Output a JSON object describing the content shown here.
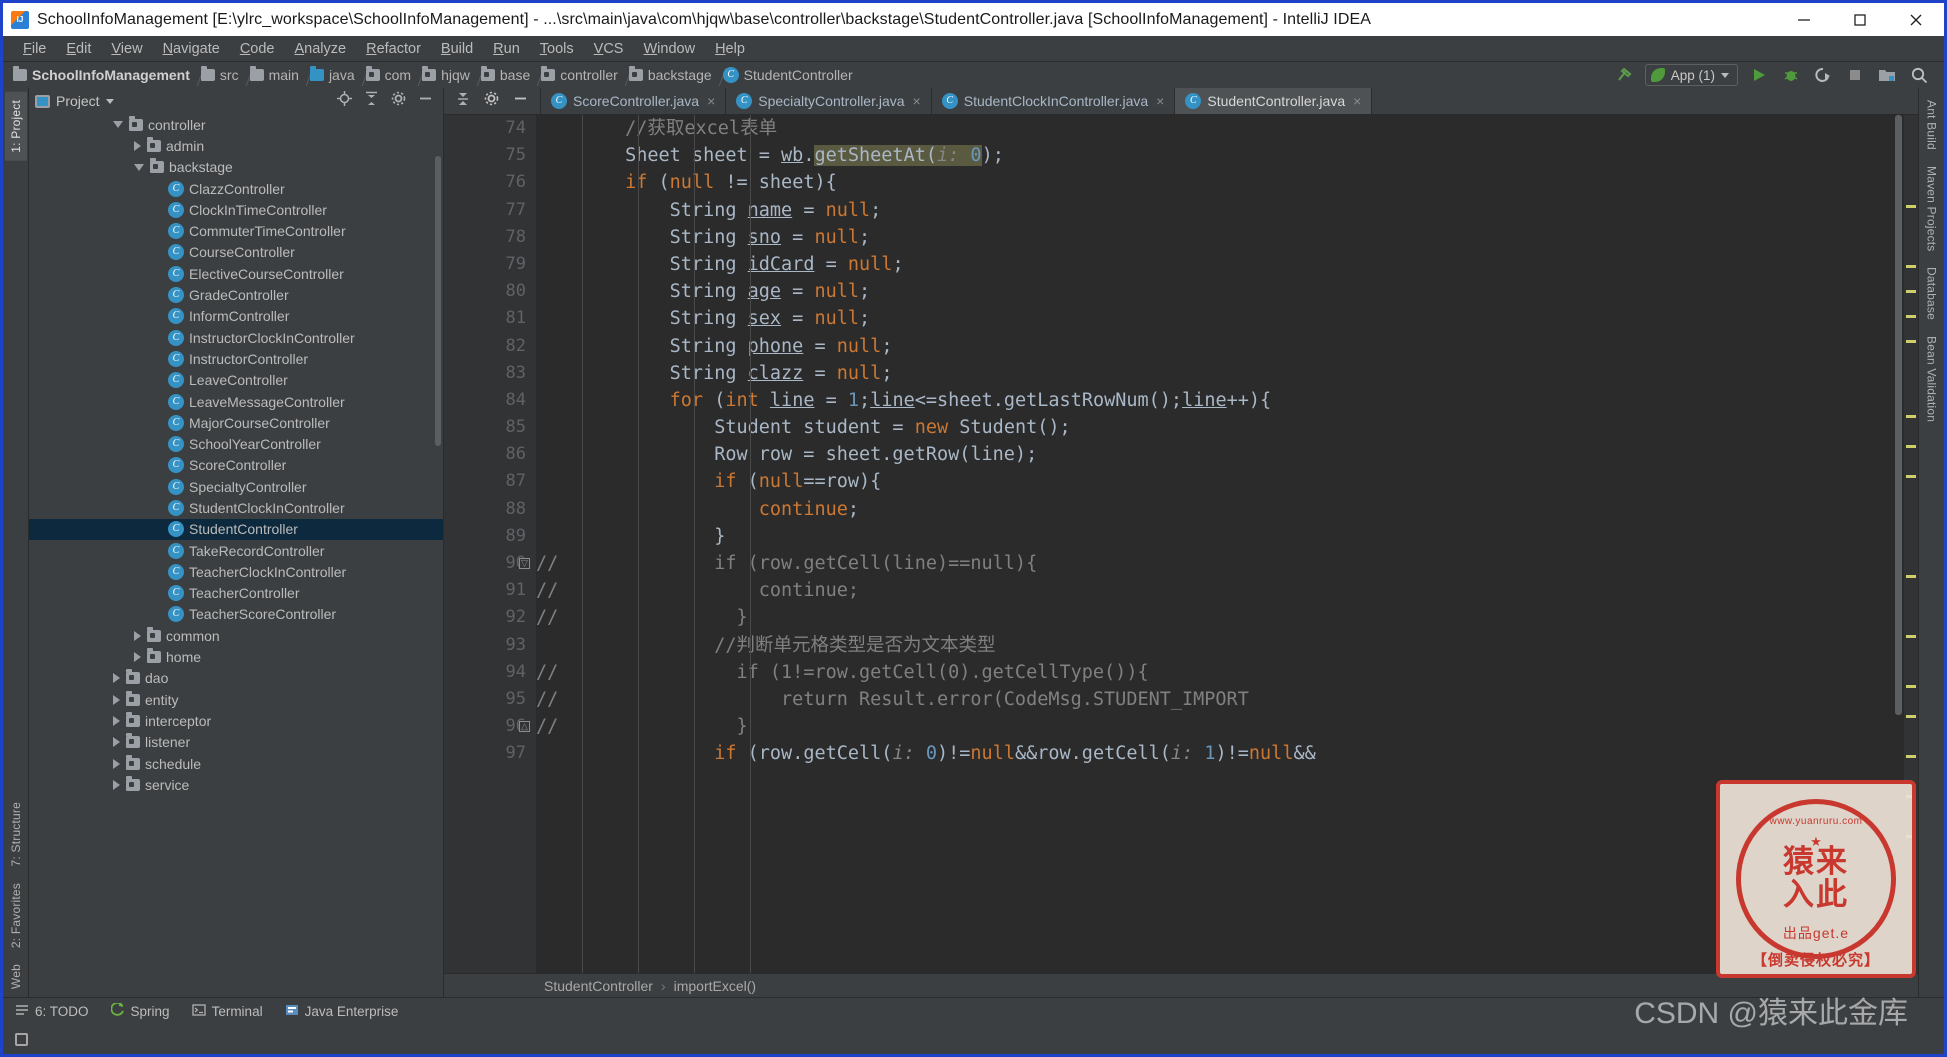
{
  "window": {
    "title": "SchoolInfoManagement [E:\\ylrc_workspace\\SchoolInfoManagement] - ...\\src\\main\\java\\com\\hjqw\\base\\controller\\backstage\\StudentController.java [SchoolInfoManagement] - IntelliJ IDEA",
    "minimize": "─",
    "maximize": "□",
    "close": "✕"
  },
  "menubar": {
    "items": [
      "File",
      "Edit",
      "View",
      "Navigate",
      "Code",
      "Analyze",
      "Refactor",
      "Build",
      "Run",
      "Tools",
      "VCS",
      "Window",
      "Help"
    ]
  },
  "breadcrumb": {
    "items": [
      {
        "label": "SchoolInfoManagement",
        "icon": "project-folder-icon"
      },
      {
        "label": "src",
        "icon": "folder-icon"
      },
      {
        "label": "main",
        "icon": "folder-icon"
      },
      {
        "label": "java",
        "icon": "source-folder-icon"
      },
      {
        "label": "com",
        "icon": "package-icon"
      },
      {
        "label": "hjqw",
        "icon": "package-icon"
      },
      {
        "label": "base",
        "icon": "package-icon"
      },
      {
        "label": "controller",
        "icon": "package-icon"
      },
      {
        "label": "backstage",
        "icon": "package-icon"
      },
      {
        "label": "StudentController",
        "icon": "class-icon"
      }
    ]
  },
  "toolbar": {
    "run_config": "App (1)",
    "run": "run-icon",
    "debug": "debug-icon",
    "coverage": "coverage-icon",
    "stop": "stop-icon",
    "project_structure": "project-structure-icon",
    "search": "search-icon",
    "build_hammer": "build-icon"
  },
  "project_panel": {
    "title": "Project",
    "actions": [
      "locate-icon",
      "collapse-all-icon",
      "settings-icon",
      "hide-icon"
    ],
    "tree": [
      {
        "label": "controller",
        "indent": 4,
        "type": "folder",
        "arrow": "open"
      },
      {
        "label": "admin",
        "indent": 5,
        "type": "folder",
        "arrow": "closed"
      },
      {
        "label": "backstage",
        "indent": 5,
        "type": "folder",
        "arrow": "open"
      },
      {
        "label": "ClazzController",
        "indent": 6,
        "type": "class",
        "arrow": "none"
      },
      {
        "label": "ClockInTimeController",
        "indent": 6,
        "type": "class",
        "arrow": "none"
      },
      {
        "label": "CommuterTimeController",
        "indent": 6,
        "type": "class",
        "arrow": "none"
      },
      {
        "label": "CourseController",
        "indent": 6,
        "type": "class",
        "arrow": "none"
      },
      {
        "label": "ElectiveCourseController",
        "indent": 6,
        "type": "class",
        "arrow": "none"
      },
      {
        "label": "GradeController",
        "indent": 6,
        "type": "class",
        "arrow": "none"
      },
      {
        "label": "InformController",
        "indent": 6,
        "type": "class",
        "arrow": "none"
      },
      {
        "label": "InstructorClockInController",
        "indent": 6,
        "type": "class",
        "arrow": "none"
      },
      {
        "label": "InstructorController",
        "indent": 6,
        "type": "class",
        "arrow": "none"
      },
      {
        "label": "LeaveController",
        "indent": 6,
        "type": "class",
        "arrow": "none"
      },
      {
        "label": "LeaveMessageController",
        "indent": 6,
        "type": "class",
        "arrow": "none"
      },
      {
        "label": "MajorCourseController",
        "indent": 6,
        "type": "class",
        "arrow": "none"
      },
      {
        "label": "SchoolYearController",
        "indent": 6,
        "type": "class",
        "arrow": "none"
      },
      {
        "label": "ScoreController",
        "indent": 6,
        "type": "class",
        "arrow": "none"
      },
      {
        "label": "SpecialtyController",
        "indent": 6,
        "type": "class",
        "arrow": "none"
      },
      {
        "label": "StudentClockInController",
        "indent": 6,
        "type": "class",
        "arrow": "none"
      },
      {
        "label": "StudentController",
        "indent": 6,
        "type": "class",
        "arrow": "none",
        "selected": true
      },
      {
        "label": "TakeRecordController",
        "indent": 6,
        "type": "class",
        "arrow": "none"
      },
      {
        "label": "TeacherClockInController",
        "indent": 6,
        "type": "class",
        "arrow": "none"
      },
      {
        "label": "TeacherController",
        "indent": 6,
        "type": "class",
        "arrow": "none"
      },
      {
        "label": "TeacherScoreController",
        "indent": 6,
        "type": "class",
        "arrow": "none"
      },
      {
        "label": "common",
        "indent": 5,
        "type": "folder",
        "arrow": "closed"
      },
      {
        "label": "home",
        "indent": 5,
        "type": "folder",
        "arrow": "closed"
      },
      {
        "label": "dao",
        "indent": 4,
        "type": "folder",
        "arrow": "closed"
      },
      {
        "label": "entity",
        "indent": 4,
        "type": "folder",
        "arrow": "closed"
      },
      {
        "label": "interceptor",
        "indent": 4,
        "type": "folder",
        "arrow": "closed"
      },
      {
        "label": "listener",
        "indent": 4,
        "type": "folder",
        "arrow": "closed"
      },
      {
        "label": "schedule",
        "indent": 4,
        "type": "folder",
        "arrow": "closed"
      },
      {
        "label": "service",
        "indent": 4,
        "type": "folder",
        "arrow": "closed"
      }
    ]
  },
  "left_tool_tabs": [
    {
      "label": "1: Project",
      "selected": true
    },
    {
      "label": "7: Structure",
      "selected": false
    },
    {
      "label": "2: Favorites",
      "selected": false
    },
    {
      "label": "Web",
      "selected": false
    }
  ],
  "right_tool_tabs": [
    {
      "label": "Ant Build"
    },
    {
      "label": "Maven Projects"
    },
    {
      "label": "Database"
    },
    {
      "label": "Bean Validation"
    }
  ],
  "editor": {
    "tabs": [
      {
        "label": "ScoreController.java",
        "active": false,
        "close": "×"
      },
      {
        "label": "SpecialtyController.java",
        "active": false,
        "close": "×"
      },
      {
        "label": "StudentClockInController.java",
        "active": false,
        "close": "×"
      },
      {
        "label": "StudentController.java",
        "active": true,
        "close": "×"
      }
    ],
    "tab_actions": [
      "collapse-icon",
      "settings-icon",
      "hide-icon"
    ],
    "first_line_number": 74,
    "lines": [
      {
        "n": 74,
        "segments": [
          {
            "t": "        ",
            "c": "plain"
          },
          {
            "t": "//获取excel表单",
            "c": "cmt"
          }
        ]
      },
      {
        "n": 75,
        "segments": [
          {
            "t": "        Sheet sheet = ",
            "c": "plain"
          },
          {
            "t": "wb",
            "c": "ul"
          },
          {
            "t": ".",
            "c": "plain"
          },
          {
            "t": "getSheetAt(",
            "c": "hl"
          },
          {
            "t": "i:",
            "c": "hlhint"
          },
          {
            "t": " ",
            "c": "hl"
          },
          {
            "t": "0",
            "c": "hlnum"
          },
          {
            "t": ");",
            "c": "plain"
          }
        ]
      },
      {
        "n": 76,
        "segments": [
          {
            "t": "        ",
            "c": "plain"
          },
          {
            "t": "if",
            "c": "kw"
          },
          {
            "t": " (",
            "c": "plain"
          },
          {
            "t": "null",
            "c": "kw"
          },
          {
            "t": " != sheet){",
            "c": "plain"
          }
        ]
      },
      {
        "n": 77,
        "segments": [
          {
            "t": "            String ",
            "c": "plain"
          },
          {
            "t": "name",
            "c": "ul"
          },
          {
            "t": " = ",
            "c": "plain"
          },
          {
            "t": "null",
            "c": "kw"
          },
          {
            "t": ";",
            "c": "plain"
          }
        ]
      },
      {
        "n": 78,
        "segments": [
          {
            "t": "            String ",
            "c": "plain"
          },
          {
            "t": "sno",
            "c": "ul"
          },
          {
            "t": " = ",
            "c": "plain"
          },
          {
            "t": "null",
            "c": "kw"
          },
          {
            "t": ";",
            "c": "plain"
          }
        ]
      },
      {
        "n": 79,
        "segments": [
          {
            "t": "            String ",
            "c": "plain"
          },
          {
            "t": "idCard",
            "c": "ul"
          },
          {
            "t": " = ",
            "c": "plain"
          },
          {
            "t": "null",
            "c": "kw"
          },
          {
            "t": ";",
            "c": "plain"
          }
        ]
      },
      {
        "n": 80,
        "segments": [
          {
            "t": "            String ",
            "c": "plain"
          },
          {
            "t": "age",
            "c": "ul"
          },
          {
            "t": " = ",
            "c": "plain"
          },
          {
            "t": "null",
            "c": "kw"
          },
          {
            "t": ";",
            "c": "plain"
          }
        ]
      },
      {
        "n": 81,
        "segments": [
          {
            "t": "            String ",
            "c": "plain"
          },
          {
            "t": "sex",
            "c": "ul"
          },
          {
            "t": " = ",
            "c": "plain"
          },
          {
            "t": "null",
            "c": "kw"
          },
          {
            "t": ";",
            "c": "plain"
          }
        ]
      },
      {
        "n": 82,
        "segments": [
          {
            "t": "            String ",
            "c": "plain"
          },
          {
            "t": "phone",
            "c": "ul"
          },
          {
            "t": " = ",
            "c": "plain"
          },
          {
            "t": "null",
            "c": "kw"
          },
          {
            "t": ";",
            "c": "plain"
          }
        ]
      },
      {
        "n": 83,
        "segments": [
          {
            "t": "            String ",
            "c": "plain"
          },
          {
            "t": "clazz",
            "c": "ul"
          },
          {
            "t": " = ",
            "c": "plain"
          },
          {
            "t": "null",
            "c": "kw"
          },
          {
            "t": ";",
            "c": "plain"
          }
        ]
      },
      {
        "n": 84,
        "segments": [
          {
            "t": "            ",
            "c": "plain"
          },
          {
            "t": "for",
            "c": "kw"
          },
          {
            "t": " (",
            "c": "plain"
          },
          {
            "t": "int",
            "c": "kw"
          },
          {
            "t": " ",
            "c": "plain"
          },
          {
            "t": "line",
            "c": "ul"
          },
          {
            "t": " = ",
            "c": "plain"
          },
          {
            "t": "1",
            "c": "num"
          },
          {
            "t": ";",
            "c": "plain"
          },
          {
            "t": "line",
            "c": "ul"
          },
          {
            "t": "<=sheet.getLastRowNum();",
            "c": "plain"
          },
          {
            "t": "line",
            "c": "ul"
          },
          {
            "t": "++){",
            "c": "plain"
          }
        ]
      },
      {
        "n": 85,
        "segments": [
          {
            "t": "                Student student = ",
            "c": "plain"
          },
          {
            "t": "new",
            "c": "kw"
          },
          {
            "t": " Student();",
            "c": "plain"
          }
        ]
      },
      {
        "n": 86,
        "segments": [
          {
            "t": "                Row row = sheet.getRow(line);",
            "c": "plain"
          }
        ]
      },
      {
        "n": 87,
        "segments": [
          {
            "t": "                ",
            "c": "plain"
          },
          {
            "t": "if",
            "c": "kw"
          },
          {
            "t": " (",
            "c": "plain"
          },
          {
            "t": "null",
            "c": "kw"
          },
          {
            "t": "==row){",
            "c": "plain"
          }
        ]
      },
      {
        "n": 88,
        "segments": [
          {
            "t": "                    ",
            "c": "plain"
          },
          {
            "t": "continue",
            "c": "kw"
          },
          {
            "t": ";",
            "c": "plain"
          }
        ]
      },
      {
        "n": 89,
        "segments": [
          {
            "t": "                }",
            "c": "plain"
          }
        ]
      },
      {
        "n": 90,
        "segments": [
          {
            "t": "//",
            "c": "cmt"
          },
          {
            "t": "              if (row.getCell(line)==null){",
            "c": "cmt"
          }
        ],
        "gutter_mark": "fold-top"
      },
      {
        "n": 91,
        "segments": [
          {
            "t": "//",
            "c": "cmt"
          },
          {
            "t": "                  continue;",
            "c": "cmt"
          }
        ]
      },
      {
        "n": 92,
        "segments": [
          {
            "t": "//",
            "c": "cmt"
          },
          {
            "t": "                }",
            "c": "cmt"
          }
        ]
      },
      {
        "n": 93,
        "segments": [
          {
            "t": "                ",
            "c": "plain"
          },
          {
            "t": "//判断单元格类型是否为文本类型",
            "c": "cmt"
          }
        ]
      },
      {
        "n": 94,
        "segments": [
          {
            "t": "//",
            "c": "cmt"
          },
          {
            "t": "                if (1!=row.getCell(0).getCellType()){",
            "c": "cmt"
          }
        ]
      },
      {
        "n": 95,
        "segments": [
          {
            "t": "//",
            "c": "cmt"
          },
          {
            "t": "                    return Result.error(CodeMsg.STUDENT_IMPORT",
            "c": "cmt"
          }
        ]
      },
      {
        "n": 96,
        "segments": [
          {
            "t": "//",
            "c": "cmt"
          },
          {
            "t": "                }",
            "c": "cmt"
          }
        ],
        "gutter_mark": "fold-bottom"
      },
      {
        "n": 97,
        "segments": [
          {
            "t": "                ",
            "c": "plain"
          },
          {
            "t": "if",
            "c": "kw"
          },
          {
            "t": " (row.getCell(",
            "c": "plain"
          },
          {
            "t": "i:",
            "c": "hint"
          },
          {
            "t": " ",
            "c": "plain"
          },
          {
            "t": "0",
            "c": "num"
          },
          {
            "t": ")!=",
            "c": "plain"
          },
          {
            "t": "null",
            "c": "kw"
          },
          {
            "t": "&&row.getCell(",
            "c": "plain"
          },
          {
            "t": "i:",
            "c": "hint"
          },
          {
            "t": " ",
            "c": "plain"
          },
          {
            "t": "1",
            "c": "num"
          },
          {
            "t": ")!=",
            "c": "plain"
          },
          {
            "t": "null",
            "c": "kw"
          },
          {
            "t": "&&",
            "c": "plain"
          }
        ]
      }
    ],
    "status_crumb": [
      "StudentController",
      "importExcel()"
    ]
  },
  "bottombar": {
    "items": [
      {
        "label": "6: TODO",
        "icon": "todo-icon"
      },
      {
        "label": "Spring",
        "icon": "spring-icon"
      },
      {
        "label": "Terminal",
        "icon": "terminal-icon"
      },
      {
        "label": "Java Enterprise",
        "icon": "java-enterprise-icon"
      }
    ]
  },
  "statusbar": {
    "layout_icon": "layout-icon"
  },
  "watermark": {
    "stamp_top": "www.yuanruru.com",
    "stamp_main_1": "猿来",
    "stamp_main_2": "入此",
    "stamp_bottom": "出品get.e",
    "stamp_note": "【倒卖侵权必究】",
    "csdn": "CSDN @猿来此金库"
  },
  "colors": {
    "accent_blue": "#3592c4",
    "selection": "#0d293e",
    "editor_bg": "#2b2b2b",
    "chrome_bg": "#3c3f41",
    "keyword": "#cc7832",
    "number": "#6897bb",
    "comment": "#808080",
    "stamp_red": "#c8382e"
  }
}
